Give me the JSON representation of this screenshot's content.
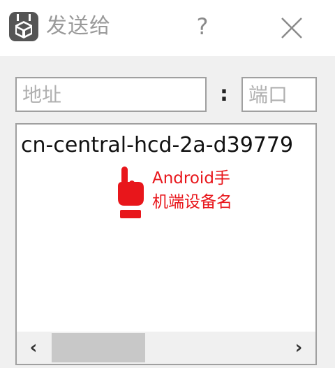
{
  "window": {
    "title": "发送给",
    "icon": "package-icon",
    "help_label": "?",
    "close_icon": "close-icon"
  },
  "form": {
    "address_placeholder": "地址",
    "address_value": "",
    "separator": ":",
    "port_placeholder": "端口",
    "port_value": ""
  },
  "device_list": {
    "items": [
      "cn-central-hcd-2a-d39779"
    ],
    "hint_icon": "pointing-hand-icon",
    "hint_line1": "Android手",
    "hint_line2": "机端设备名",
    "hint_color": "#e8161b"
  },
  "scrollbar": {
    "left_arrow": "‹",
    "right_arrow": "›",
    "position": 0.0
  }
}
